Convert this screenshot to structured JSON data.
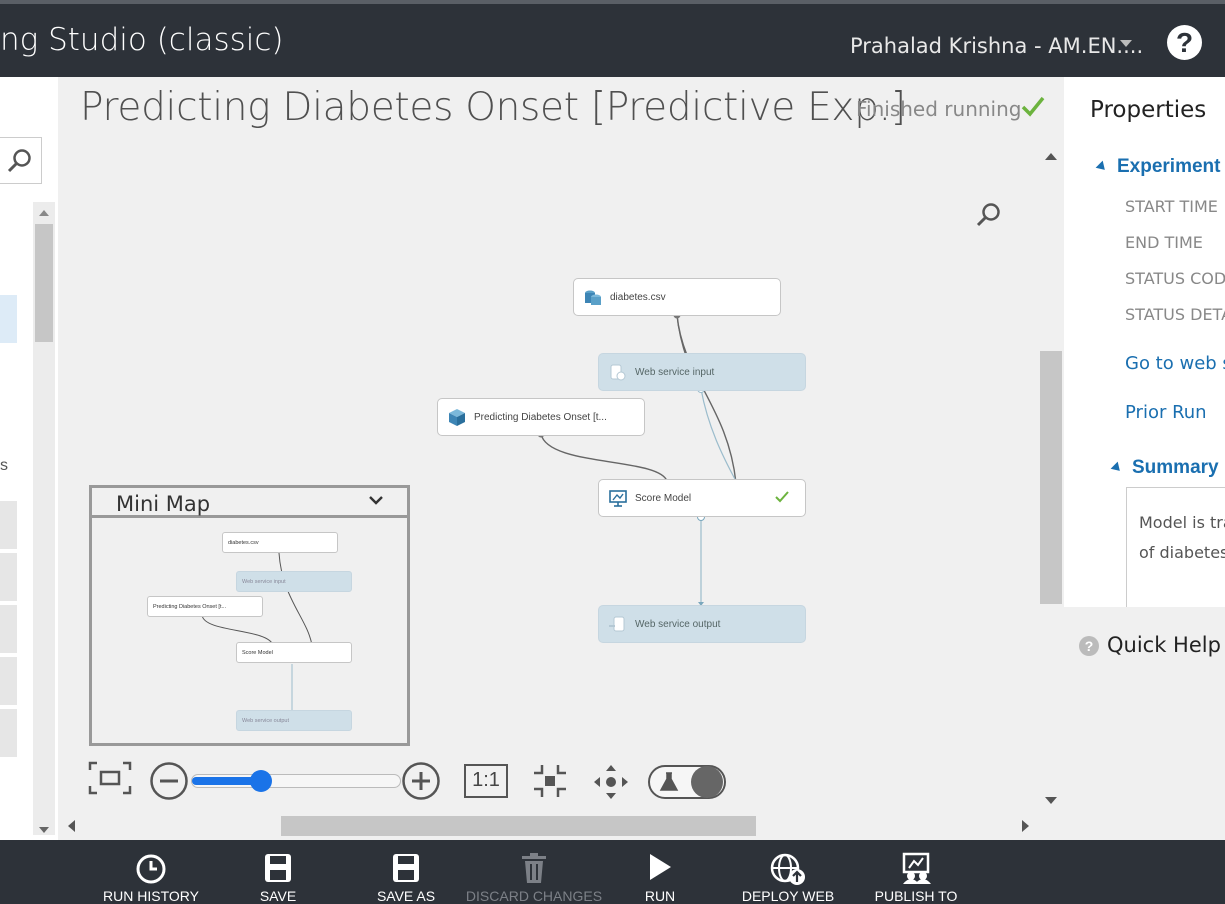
{
  "header": {
    "app_title": "ng Studio (classic)",
    "user": "Prahalad Krishna - AM.EN....",
    "help": "?"
  },
  "experiment": {
    "title": "Predicting Diabetes Onset [Predictive Exp.]",
    "status": "Finished running"
  },
  "modules": [
    {
      "label": "diabetes.csv",
      "kind": "dataset"
    },
    {
      "label": "Web service input",
      "kind": "web-service"
    },
    {
      "label": "Predicting Diabetes Onset [t...",
      "kind": "trained-model"
    },
    {
      "label": "Score Model",
      "kind": "score",
      "finished": true
    },
    {
      "label": "Web service output",
      "kind": "web-service"
    }
  ],
  "minimap": {
    "label": "Mini Map",
    "modules": [
      "diabetes.csv",
      "Web service input",
      "Predicting Diabetes Onset [t...",
      "Score Model",
      "Web service output"
    ]
  },
  "zoom": {
    "level": 0.33,
    "one_to_one": "1:1"
  },
  "properties": {
    "title": "Properties",
    "experiment_section": "Experiment",
    "keys": [
      "START TIME",
      "END TIME",
      "STATUS COD",
      "STATUS DETA"
    ],
    "links": [
      "Go to web s",
      "Prior Run"
    ],
    "summary_section": "Summary",
    "summary_lines": [
      "Model is tra",
      "of diabetes"
    ]
  },
  "quick_help": {
    "label": "Quick Help"
  },
  "commands": [
    {
      "label": "RUN HISTORY",
      "icon": "clock-icon",
      "enabled": true
    },
    {
      "label": "SAVE",
      "icon": "floppy-icon",
      "enabled": true
    },
    {
      "label": "SAVE AS",
      "icon": "floppy-icon",
      "enabled": true
    },
    {
      "label": "DISCARD CHANGES",
      "icon": "trash-icon",
      "enabled": false
    },
    {
      "label": "RUN",
      "icon": "play-icon",
      "enabled": true
    },
    {
      "label": "DEPLOY WEB",
      "icon": "globe-upload-icon",
      "enabled": true
    },
    {
      "label": "PUBLISH TO",
      "icon": "publish-icon",
      "enabled": true
    }
  ],
  "colors": {
    "header_bg": "#2d3239",
    "canvas_bg": "#f0f0f0",
    "accent_blue": "#1a6fb0",
    "success_green": "#6cb33e",
    "web_service_module": "#cfdfe8"
  }
}
